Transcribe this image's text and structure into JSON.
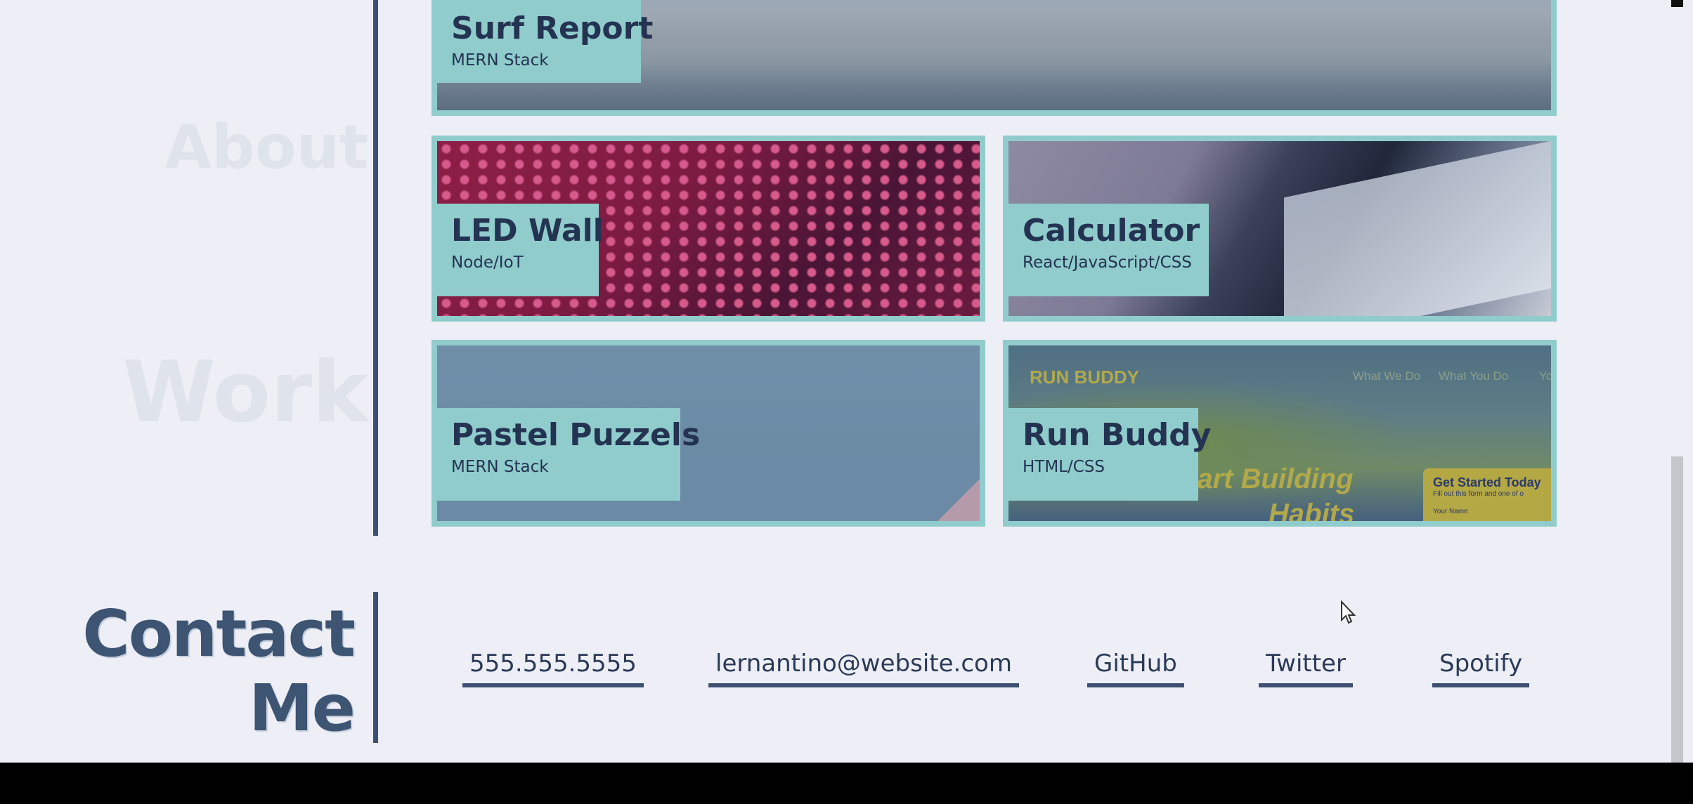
{
  "sidebar_ghost": {
    "about_heading": "About",
    "work_heading": "Work"
  },
  "projects": [
    {
      "title": "Surf Report",
      "stack": "MERN Stack"
    },
    {
      "title": "LED Wall",
      "stack": "Node/IoT"
    },
    {
      "title": "Calculator",
      "stack": "React/JavaScript/CSS"
    },
    {
      "title": "Pastel Puzzels",
      "stack": "MERN Stack"
    },
    {
      "title": "Run Buddy",
      "stack": "HTML/CSS"
    }
  ],
  "run_buddy_preview": {
    "logo": "RUN BUDDY",
    "nav": [
      "What We Do",
      "What You Do",
      "Yo"
    ],
    "hero_line1": "tart Building",
    "hero_line2": "Habits",
    "form_title": "Get Started Today",
    "form_sub": "Fill out this form and one of o",
    "form_field": "Your Name"
  },
  "contact": {
    "title_line1": "Contact",
    "title_line2": "Me",
    "links": [
      {
        "label": "555.555.5555"
      },
      {
        "label": "lernantino@website.com"
      },
      {
        "label": "GitHub"
      },
      {
        "label": "Twitter"
      },
      {
        "label": "Spotify"
      }
    ]
  },
  "colors": {
    "background": "#eeeff6",
    "accent": "#90cccc",
    "navy": "#3d4f72",
    "text": "#243352"
  }
}
